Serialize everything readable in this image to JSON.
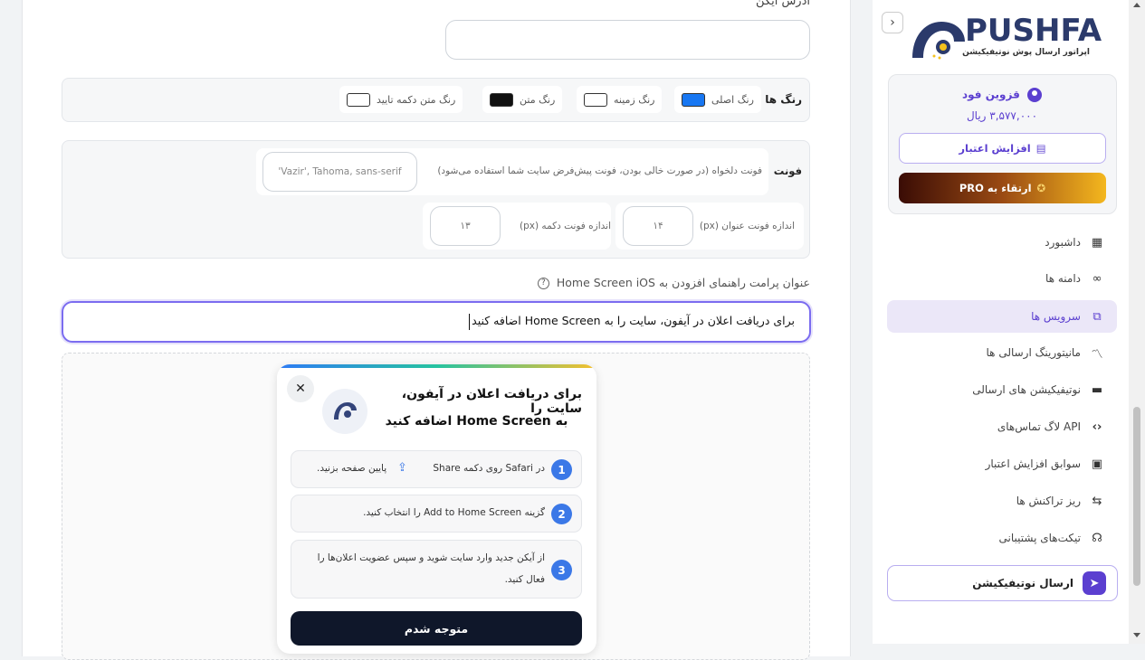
{
  "main": {
    "icon_address_label": "آدرس آیکن",
    "icon_address_value": "",
    "colors": {
      "title": "رنگ ها",
      "items": [
        {
          "label": "رنگ اصلی",
          "color": "#1877f2"
        },
        {
          "label": "رنگ زمینه",
          "color": "#ffffff"
        },
        {
          "label": "رنگ متن",
          "color": "#111111"
        },
        {
          "label": "رنگ متن دکمه تایید",
          "color": "#ffffff"
        }
      ]
    },
    "font": {
      "title": "فونت",
      "custom_label": "فونت دلخواه (در صورت خالی بودن، فونت پیش‌فرض سایت شما استفاده می‌شود)",
      "custom_placeholder": "'Vazir', Tahoma, sans-serif",
      "title_size_label": "اندازه فونت عنوان (px)",
      "title_size_value": "۱۴",
      "button_size_label": "اندازه فونت دکمه (px)",
      "button_size_value": "۱۳"
    },
    "prompt_title_label": "عنوان پرامت راهنمای افزودن به Home Screen iOS",
    "prompt_title_value": "برای دریافت اعلان در آیفون، سایت را به Home Screen اضافه کنید",
    "preview": {
      "title_line1": "برای دریافت اعلان در آیفون، سایت را",
      "title_line2": "به Home Screen اضافه کنید",
      "close_symbol": "✕",
      "steps": [
        {
          "num": "1",
          "text_a": "در Safari روی دکمه Share",
          "text_b": "پایین صفحه بزنید."
        },
        {
          "num": "2",
          "text": "گزینه Add to Home Screen را انتخاب کنید."
        },
        {
          "num": "3",
          "text_line1": "از آیکن جدید وارد سایت شوید و سپس عضویت اعلان‌ها را",
          "text_line2": "فعال کنید."
        }
      ],
      "confirm_button": "متوجه شدم"
    }
  },
  "sidebar": {
    "brand": "PUSHFA",
    "tagline": "اپراتور ارسال پوش نوتیفیکیشن",
    "user_name": "قزوین فود",
    "balance": "۳,۵۷۷,۰۰۰ ریال",
    "add_credit": "افزایش اعتبار",
    "upgrade": "ارتقاء به PRO",
    "nav": [
      {
        "label": "داشبورد",
        "icon": "dashboard-icon"
      },
      {
        "label": "دامنه ها",
        "icon": "link-icon"
      },
      {
        "label": "سرویس ها",
        "icon": "services-icon",
        "active": true
      },
      {
        "label": "مانیتورینگ ارسالی ها",
        "icon": "chart-line-icon"
      },
      {
        "label": "نوتیفیکیشن های ارسالی",
        "icon": "inbox-icon"
      },
      {
        "label": "لاگ تماس‌های API",
        "icon": "code-icon"
      },
      {
        "label": "سوابق افزایش اعتبار",
        "icon": "money-icon"
      },
      {
        "label": "ریز تراکنش ها",
        "icon": "transactions-icon"
      },
      {
        "label": "تیکت‌های پشتیبانی",
        "icon": "headset-icon"
      }
    ],
    "send_notification": "ارسال نوتیفیکیشن",
    "collapse_symbol": "›"
  }
}
